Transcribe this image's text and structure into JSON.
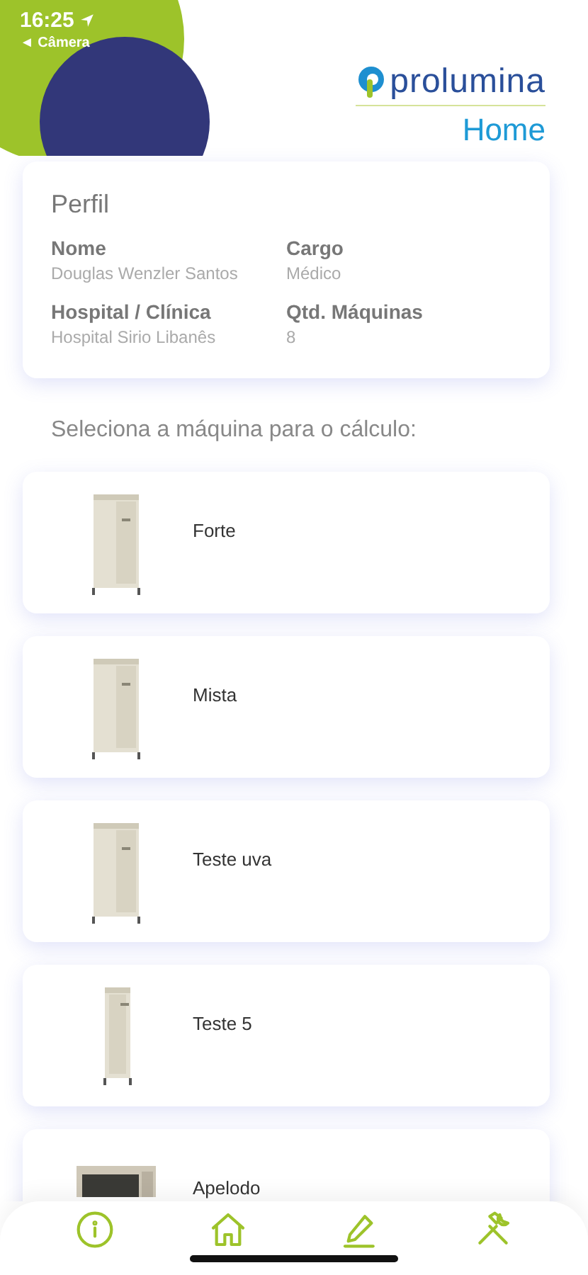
{
  "status_bar": {
    "time": "16:25",
    "back_label": "◄ Câmera"
  },
  "header": {
    "brand": "prolumina",
    "page_title": "Home"
  },
  "profile": {
    "title": "Perfil",
    "fields": [
      {
        "label": "Nome",
        "value": "Douglas Wenzler Santos"
      },
      {
        "label": "Cargo",
        "value": "Médico"
      },
      {
        "label": "Hospital / Clínica",
        "value": "Hospital Sirio Libanês"
      },
      {
        "label": "Qtd. Máquinas",
        "value": "8"
      }
    ]
  },
  "prompt": "Seleciona a máquina para o cálculo:",
  "machines": [
    {
      "name": "Forte"
    },
    {
      "name": "Mista"
    },
    {
      "name": "Teste uva"
    },
    {
      "name": "Teste 5"
    },
    {
      "name": "Apelodo"
    }
  ],
  "tab_bar": {
    "items": [
      {
        "kind": "info"
      },
      {
        "kind": "home"
      },
      {
        "kind": "edit"
      },
      {
        "kind": "tools"
      }
    ]
  }
}
